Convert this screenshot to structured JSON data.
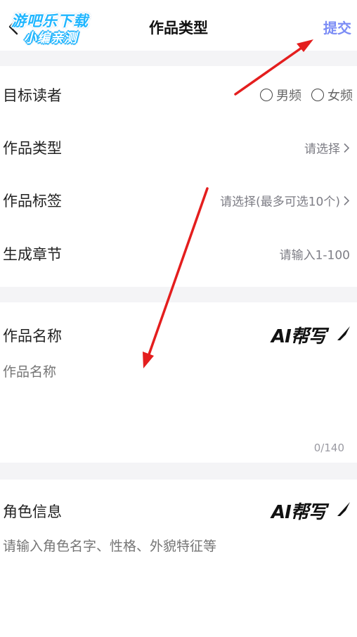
{
  "header": {
    "title": "作品类型",
    "submit_label": "提交",
    "watermark_line1": "游吧乐下载",
    "watermark_line2": "小编亲测",
    "back_icon": "chevron-left-icon"
  },
  "rows": {
    "audience": {
      "label": "目标读者",
      "option_male": "男频",
      "option_female": "女频"
    },
    "work_type": {
      "label": "作品类型",
      "value": "请选择"
    },
    "work_tags": {
      "label": "作品标签",
      "value": "请选择(最多可选10个)"
    },
    "chapters": {
      "label": "生成章节",
      "placeholder": "请输入1-100"
    }
  },
  "name_section": {
    "label": "作品名称",
    "ai_label": "AI帮写",
    "placeholder": "作品名称",
    "counter": "0/140"
  },
  "role_section": {
    "label": "角色信息",
    "ai_label": "AI帮写",
    "placeholder": "请输入角色名字、性格、外貌特征等"
  },
  "colors": {
    "accent": "#7b8cf5",
    "annotation_arrow": "#e41e1e",
    "divider": "#f4f4f6"
  }
}
